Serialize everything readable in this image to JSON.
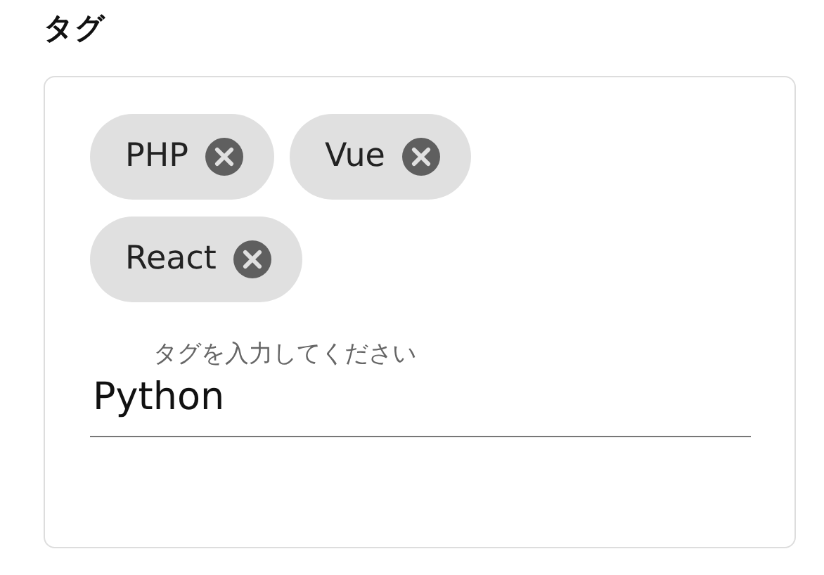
{
  "title": "タグ",
  "tags": [
    {
      "label": "PHP"
    },
    {
      "label": "Vue"
    },
    {
      "label": "React"
    }
  ],
  "input": {
    "label": "タグを入力してください",
    "value": "Python"
  }
}
